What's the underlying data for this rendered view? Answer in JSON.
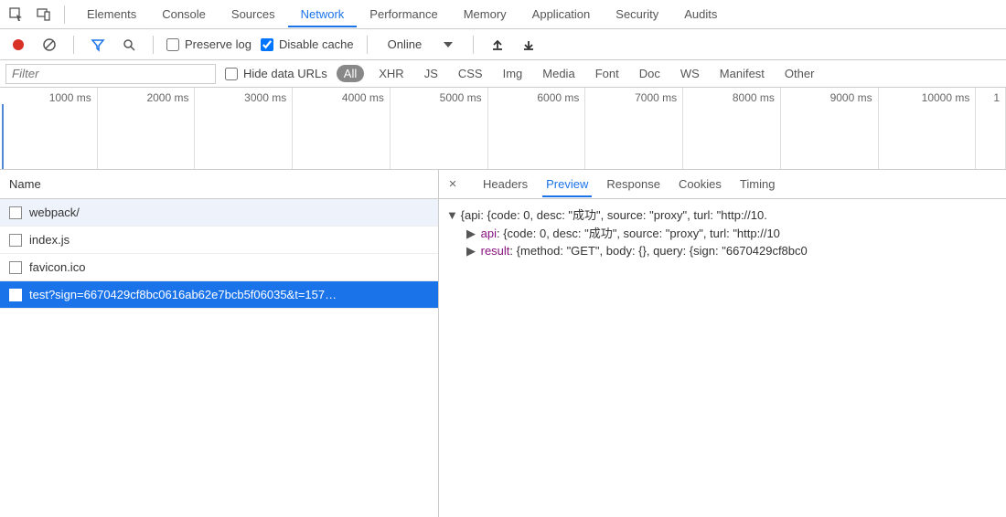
{
  "main_tabs": {
    "items": [
      "Elements",
      "Console",
      "Sources",
      "Network",
      "Performance",
      "Memory",
      "Application",
      "Security",
      "Audits"
    ],
    "active_index": 3
  },
  "network_toolbar": {
    "preserve_log_label": "Preserve log",
    "preserve_log_checked": false,
    "disable_cache_label": "Disable cache",
    "disable_cache_checked": true,
    "online_label": "Online"
  },
  "filter_row": {
    "filter_placeholder": "Filter",
    "hide_data_urls_label": "Hide data URLs",
    "hide_data_urls_checked": false,
    "types": [
      "All",
      "XHR",
      "JS",
      "CSS",
      "Img",
      "Media",
      "Font",
      "Doc",
      "WS",
      "Manifest",
      "Other"
    ],
    "active_type_index": 0
  },
  "timeline": {
    "ticks": [
      "1000 ms",
      "2000 ms",
      "3000 ms",
      "4000 ms",
      "5000 ms",
      "6000 ms",
      "7000 ms",
      "8000 ms",
      "9000 ms",
      "10000 ms",
      "1"
    ]
  },
  "requests": {
    "header": "Name",
    "items": [
      {
        "name": "webpack/",
        "selected": false,
        "alt": true
      },
      {
        "name": "index.js",
        "selected": false,
        "alt": false
      },
      {
        "name": "favicon.ico",
        "selected": false,
        "alt": false
      },
      {
        "name": "test?sign=6670429cf8bc0616ab62e7bcb5f06035&t=157…",
        "selected": true,
        "alt": false
      }
    ]
  },
  "detail": {
    "tabs": [
      "Headers",
      "Preview",
      "Response",
      "Cookies",
      "Timing"
    ],
    "active_index": 1,
    "preview": {
      "root": "{api: {code: 0, desc: \"成功\", source: \"proxy\", turl: \"http://10.",
      "api_key": "api",
      "api_value": ": {code: 0, desc: \"成功\", source: \"proxy\", turl: \"http://10",
      "result_key": "result",
      "result_value": ": {method: \"GET\", body: {}, query: {sign: \"6670429cf8bc0"
    }
  }
}
